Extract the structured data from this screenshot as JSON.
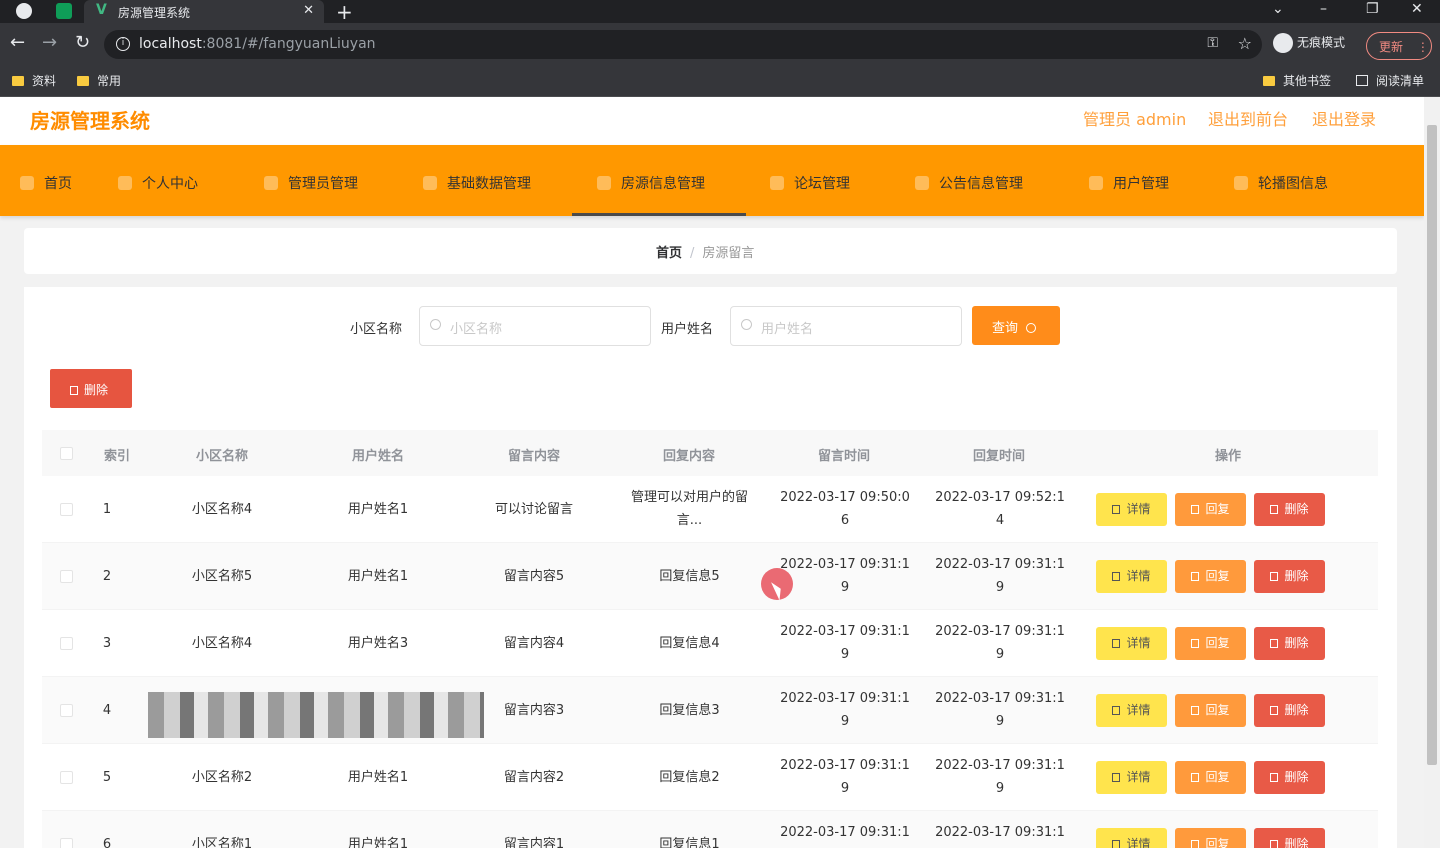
{
  "browser": {
    "tab_title": "房源管理系统",
    "url_host": "localhost",
    "url_rest": ":8081/#/fangyuanLiuyan",
    "incognito_label": "无痕模式",
    "update_label": "更新",
    "bookmarks": [
      "资料",
      "常用"
    ],
    "bookmarks_right": [
      "其他书签",
      "阅读清单"
    ]
  },
  "header": {
    "title": "房源管理系统",
    "links": [
      "管理员 admin",
      "退出到前台",
      "退出登录"
    ]
  },
  "menu": {
    "items": [
      "首页",
      "个人中心",
      "管理员管理",
      "基础数据管理",
      "房源信息管理",
      "论坛管理",
      "公告信息管理",
      "用户管理",
      "轮播图信息"
    ],
    "active": "房源信息管理"
  },
  "breadcrumb": {
    "home": "首页",
    "current": "房源留言"
  },
  "search": {
    "community_label": "小区名称",
    "community_placeholder": "小区名称",
    "user_label": "用户姓名",
    "user_placeholder": "用户姓名",
    "query_button": "查询"
  },
  "toolbar": {
    "delete_label": "删除"
  },
  "table": {
    "columns": [
      "索引",
      "小区名称",
      "用户姓名",
      "留言内容",
      "回复内容",
      "留言时间",
      "回复时间",
      "操作"
    ],
    "actions": {
      "detail": "详情",
      "reply": "回复",
      "delete": "删除"
    },
    "rows": [
      {
        "index": "1",
        "community": "小区名称4",
        "user": "用户姓名1",
        "message": "可以讨论留言",
        "reply": "管理可以对用户的留",
        "reply2": "言...",
        "msg_time": "2022-03-17 09:50:0",
        "msg_time2": "6",
        "reply_time": "2022-03-17 09:52:1",
        "reply_time2": "4"
      },
      {
        "index": "2",
        "community": "小区名称5",
        "user": "用户姓名1",
        "message": "留言内容5",
        "reply": "回复信息5",
        "reply2": "",
        "msg_time": "2022-03-17 09:31:1",
        "msg_time2": "9",
        "reply_time": "2022-03-17 09:31:1",
        "reply_time2": "9"
      },
      {
        "index": "3",
        "community": "小区名称4",
        "user": "用户姓名3",
        "message": "留言内容4",
        "reply": "回复信息4",
        "reply2": "",
        "msg_time": "2022-03-17 09:31:1",
        "msg_time2": "9",
        "reply_time": "2022-03-17 09:31:1",
        "reply_time2": "9"
      },
      {
        "index": "4",
        "community": "",
        "user": "",
        "message": "留言内容3",
        "reply": "回复信息3",
        "reply2": "",
        "msg_time": "2022-03-17 09:31:1",
        "msg_time2": "9",
        "reply_time": "2022-03-17 09:31:1",
        "reply_time2": "9"
      },
      {
        "index": "5",
        "community": "小区名称2",
        "user": "用户姓名1",
        "message": "留言内容2",
        "reply": "回复信息2",
        "reply2": "",
        "msg_time": "2022-03-17 09:31:1",
        "msg_time2": "9",
        "reply_time": "2022-03-17 09:31:1",
        "reply_time2": "9"
      },
      {
        "index": "6",
        "community": "小区名称1",
        "user": "用户姓名1",
        "message": "留言内容1",
        "reply": "回复信息1",
        "reply2": "",
        "msg_time": "2022-03-17 09:31:1",
        "msg_time2": "",
        "reply_time": "2022-03-17 09:31:1",
        "reply_time2": ""
      }
    ]
  },
  "colors": {
    "accent": "#ff9800",
    "title": "#ff8c00",
    "detail": "#ffe44d",
    "reply": "#ff9a3c",
    "delete": "#e85a47"
  }
}
